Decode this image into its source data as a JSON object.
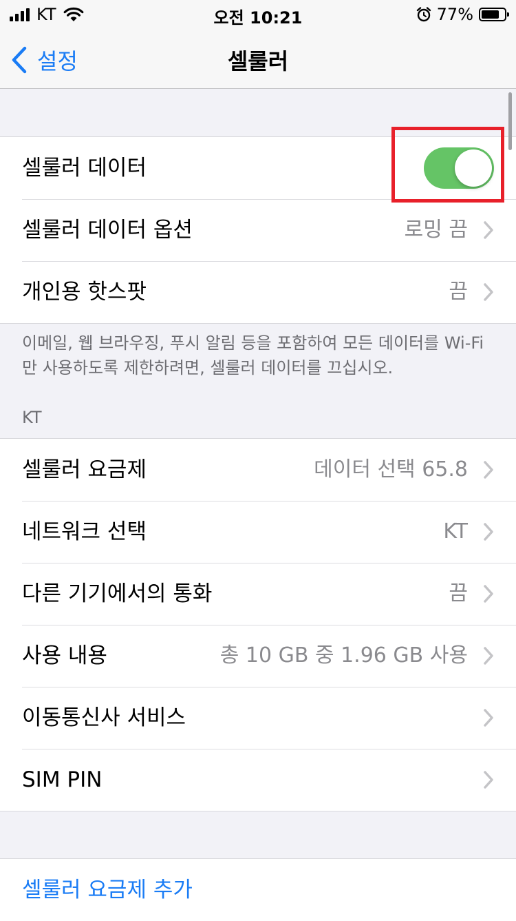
{
  "status_bar": {
    "carrier": "KT",
    "time": "오전 10:21",
    "battery_percent": "77%",
    "battery_level": 0.77,
    "icons": [
      "cellular-signal-icon",
      "wifi-icon",
      "alarm-icon",
      "battery-icon"
    ]
  },
  "nav": {
    "back_label": "설정",
    "title": "셀룰러"
  },
  "group1": {
    "cellular_data": {
      "label": "셀룰러 데이터",
      "toggle_on": true
    },
    "cellular_data_options": {
      "label": "셀룰러 데이터 옵션",
      "value": "로밍 끔"
    },
    "personal_hotspot": {
      "label": "개인용 핫스팟",
      "value": "끔"
    }
  },
  "group1_footer": "이메일, 웹 브라우징, 푸시 알림 등을 포함하여 모든 데이터를 Wi-Fi 만 사용하도록 제한하려면, 셀룰러 데이터를 끄십시오.",
  "kt_section": {
    "header": "KT",
    "rows": [
      {
        "label": "셀룰러 요금제",
        "value": "데이터 선택 65.8"
      },
      {
        "label": "네트워크 선택",
        "value": "KT"
      },
      {
        "label": "다른 기기에서의 통화",
        "value": "끔"
      },
      {
        "label": "사용 내용",
        "value": "총 10 GB 중 1.96 GB 사용"
      },
      {
        "label": "이동통신사 서비스",
        "value": ""
      },
      {
        "label": "SIM PIN",
        "value": ""
      }
    ]
  },
  "add_plan": {
    "label": "셀룰러 요금제 추가"
  },
  "colors": {
    "accent": "#1a7cf5",
    "toggle_on": "#65c466",
    "highlight": "#e8202a",
    "background": "#f2f2f7"
  }
}
